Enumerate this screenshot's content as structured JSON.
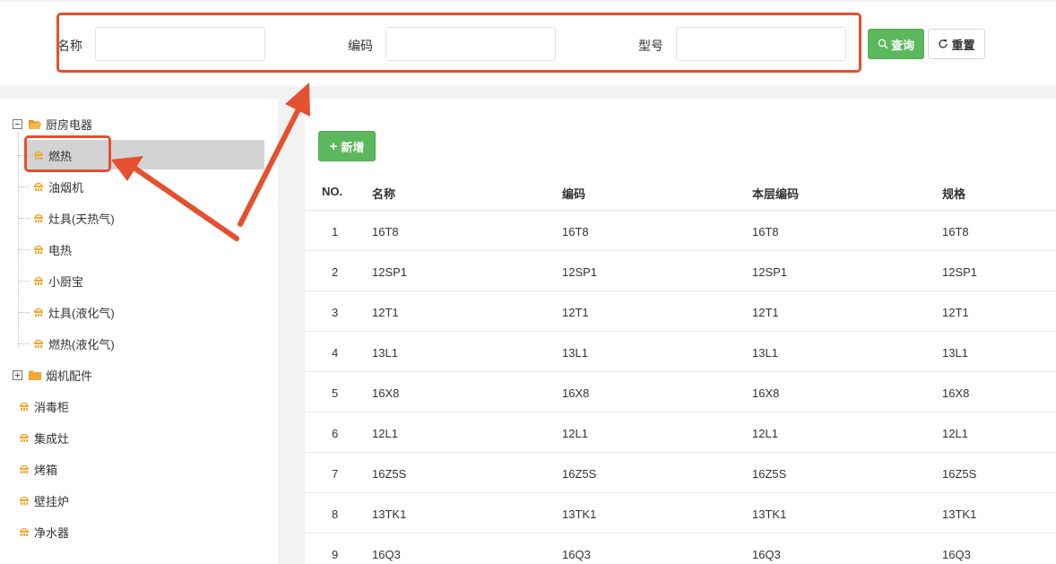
{
  "search": {
    "name_label": "名称",
    "code_label": "编码",
    "model_label": "型号",
    "name_value": "",
    "code_value": "",
    "model_value": "",
    "query_label": "查询",
    "reset_label": "重置"
  },
  "tree": {
    "root": "厨房电器",
    "children": [
      "燃热",
      "油烟机",
      "灶具(天热气)",
      "电热",
      "小厨宝",
      "灶具(液化气)",
      "燃热(液化气)"
    ],
    "others": [
      "烟机配件",
      "消毒柜",
      "集成灶",
      "烤箱",
      "壁挂炉",
      "净水器"
    ],
    "selected": "燃热"
  },
  "toolbar": {
    "add_label": "新增"
  },
  "table": {
    "headers": [
      "NO.",
      "名称",
      "编码",
      "本层编码",
      "规格"
    ],
    "rows": [
      [
        "1",
        "16T8",
        "16T8",
        "16T8",
        "16T8"
      ],
      [
        "2",
        "12SP1",
        "12SP1",
        "12SP1",
        "12SP1"
      ],
      [
        "3",
        "12T1",
        "12T1",
        "12T1",
        "12T1"
      ],
      [
        "4",
        "13L1",
        "13L1",
        "13L1",
        "13L1"
      ],
      [
        "5",
        "16X8",
        "16X8",
        "16X8",
        "16X8"
      ],
      [
        "6",
        "12L1",
        "12L1",
        "12L1",
        "12L1"
      ],
      [
        "7",
        "16Z5S",
        "16Z5S",
        "16Z5S",
        "16Z5S"
      ],
      [
        "8",
        "13TK1",
        "13TK1",
        "13TK1",
        "13TK1"
      ],
      [
        "9",
        "16Q3",
        "16Q3",
        "16Q3",
        "16Q3"
      ]
    ]
  },
  "colors": {
    "accent_green": "#5cb85c",
    "annotation_red": "#e5502f",
    "folder_orange": "#f0a830",
    "selected_gray": "#d3d3d3"
  },
  "icons": {
    "folder_open": "folder-open-icon",
    "folder": "folder-icon",
    "item": "tree-item-icon",
    "search": "search-icon",
    "reset": "refresh-icon",
    "add": "plus-icon"
  }
}
